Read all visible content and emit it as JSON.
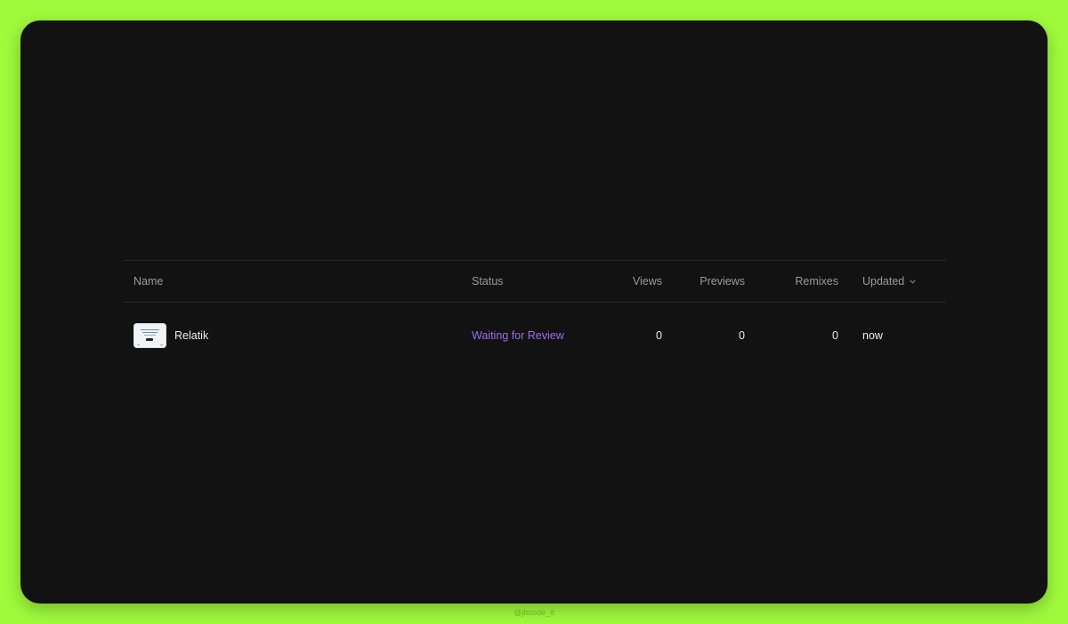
{
  "table": {
    "columns": {
      "name": "Name",
      "status": "Status",
      "views": "Views",
      "previews": "Previews",
      "remixes": "Remixes",
      "updated": "Updated"
    },
    "rows": [
      {
        "name": "Relatik",
        "status": "Waiting for Review",
        "views": "0",
        "previews": "0",
        "remixes": "0",
        "updated": "now"
      }
    ]
  },
  "icons": {
    "sort": "chevron-down-icon",
    "thumbnail": "project-thumbnail"
  },
  "colors": {
    "page_background": "#9ffa3c",
    "panel_background": "#121212",
    "status_accent": "#a06cf2"
  },
  "watermark": "@jbcode_it"
}
